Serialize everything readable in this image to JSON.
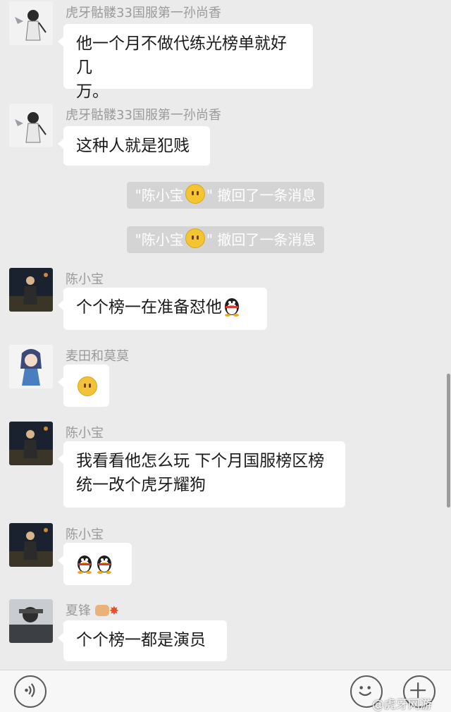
{
  "messages": [
    {
      "sender": "虎牙骷髅33国服第一孙尚香",
      "text1": "他一个月不做代练光榜单就好几",
      "text2": "万。"
    },
    {
      "sender": "虎牙骷髅33国服第一孙尚香",
      "text": "这种人就是犯贱"
    },
    {
      "recall_prefix": "\"陈小宝",
      "recall_suffix": "\" 撤回了一条消息"
    },
    {
      "recall_prefix": "\"陈小宝",
      "recall_suffix": "\" 撤回了一条消息"
    },
    {
      "sender": "陈小宝",
      "text": "个个榜一在准备怼他"
    },
    {
      "sender": "麦田和莫莫",
      "text": ""
    },
    {
      "sender": "陈小宝",
      "text1": "我看看他怎么玩 下个月国服榜区榜",
      "text2": "统一改个虎牙耀狗"
    },
    {
      "sender": "陈小宝",
      "text": ""
    },
    {
      "sender": "夏锋",
      "text": "个个榜一都是演员"
    }
  ],
  "icons": {
    "voice": "voice-icon",
    "emoji": "emoji-icon",
    "more": "plus-icon"
  },
  "watermark": "@虎牙网游"
}
